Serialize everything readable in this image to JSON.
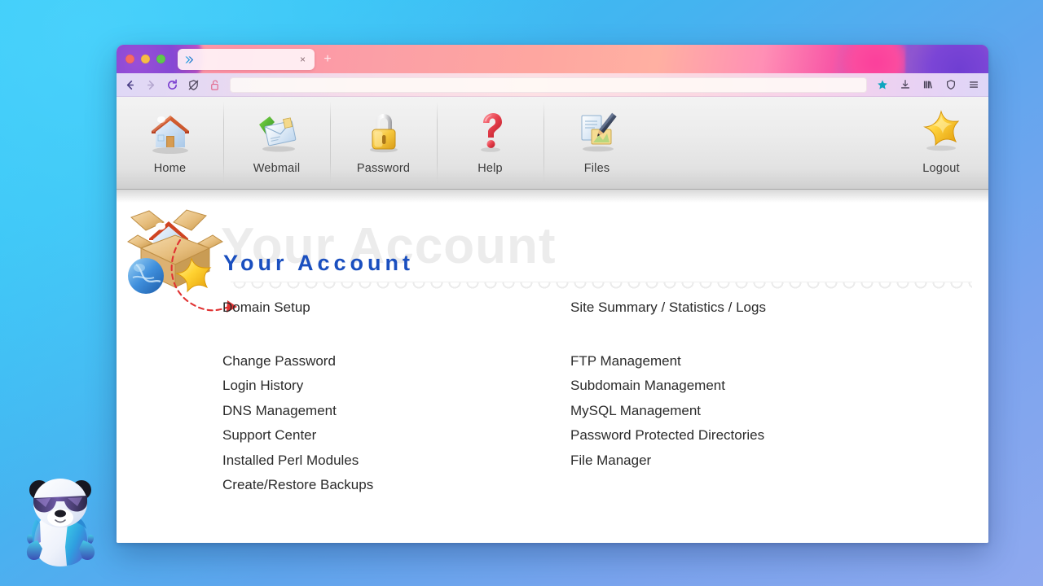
{
  "window": {
    "traffic_lights": [
      "close",
      "minimize",
      "maximize"
    ],
    "tab": {
      "title": "",
      "favicon": "double-chevron-right-icon",
      "close_label": "×"
    },
    "new_tab_label": "+",
    "nav": {
      "back_label": "←",
      "forward_label": "→",
      "reload_label": "↻",
      "tracking_protection": "shield-slash-icon",
      "site_security": "unlocked-padlock-icon",
      "url_value": "",
      "url_placeholder": "",
      "bookmark": "star-icon",
      "downloads": "download-icon",
      "library": "library-icon",
      "shield": "shield-icon",
      "menu": "hamburger-menu-icon"
    }
  },
  "toolbar": {
    "items": [
      {
        "label": "Home",
        "icon": "house-icon"
      },
      {
        "label": "Webmail",
        "icon": "envelope-arrow-icon"
      },
      {
        "label": "Password",
        "icon": "padlock-icon"
      },
      {
        "label": "Help",
        "icon": "question-mark-icon"
      },
      {
        "label": "Files",
        "icon": "document-pencil-icon"
      }
    ],
    "logout": {
      "label": "Logout",
      "icon": "star-icon"
    }
  },
  "banner": {
    "title": "Your Account",
    "watermark": "Your Account",
    "logo": "box-house-globe-star-icon",
    "pointer": "red-dashed-arrow-icon"
  },
  "main": {
    "columns": [
      {
        "highlighted": [
          "Domain Setup"
        ],
        "links": [
          "Change Password",
          "Login History",
          "DNS Management",
          "Support Center",
          "Installed Perl Modules",
          "Create/Restore Backups"
        ]
      },
      {
        "highlighted": [
          "Site Summary / Statistics / Logs"
        ],
        "links": [
          "FTP Management",
          "Subdomain Management",
          "MySQL Management",
          "Password Protected Directories",
          "File Manager"
        ]
      }
    ]
  },
  "mascot": {
    "name": "panda-mascot-icon"
  },
  "colors": {
    "accent_blue": "#1a4fbf",
    "desktop_top": "#33c6f7",
    "desktop_bottom": "#8fa9ef",
    "titlebar_pink": "#fb9fa6",
    "titlebar_purple": "#6b3fd0",
    "watermark_gray": "#ececec",
    "pointer_red": "#e03232"
  }
}
